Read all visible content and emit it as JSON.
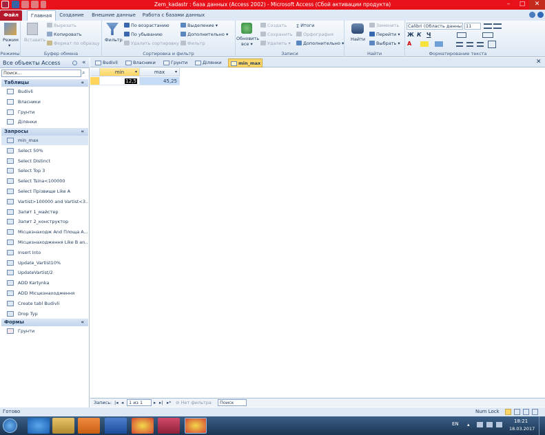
{
  "window": {
    "title": "Zem_kadastr : база данных (Access 2002) - Microsoft Access (Сбой активации продукта)"
  },
  "ribbon_tabs": [
    "Файл",
    "Главная",
    "Создание",
    "Внешние данные",
    "Работа с базами данных"
  ],
  "ribbon": {
    "views": {
      "label": "Режим",
      "group": "Режимы"
    },
    "clipboard": {
      "paste": "Вставить",
      "cut": "Вырезать",
      "copy": "Копировать",
      "format_painter": "Формат по образцу",
      "group": "Буфер обмена"
    },
    "sort_filter": {
      "filter": "Фильтр",
      "ascending": "По возрастанию",
      "descending": "По убыванию",
      "remove_sort": "Удалить сортировку",
      "selection": "Выделение",
      "advanced": "Дополнительно",
      "toggle_filter": "Фильтр",
      "group": "Сортировка и фильтр"
    },
    "records": {
      "refresh": "Обновить",
      "refresh_sub": "все",
      "new": "Создать",
      "save": "Сохранить",
      "delete": "Удалить",
      "totals": "Итоги",
      "spelling": "Орфография",
      "more": "Дополнительно",
      "group": "Записи"
    },
    "find": {
      "find": "Найти",
      "replace": "Заменить",
      "goto": "Перейти",
      "select": "Выбрать",
      "group": "Найти"
    },
    "text_format": {
      "font": "Calibri (Область данны",
      "size": "11",
      "group": "Форматирование текста"
    }
  },
  "nav": {
    "header": "Все объекты Access",
    "search_placeholder": "Поиск...",
    "categories": {
      "tables": {
        "label": "Таблицы",
        "items": [
          "Budivli",
          "Власники",
          "Грунти",
          "Ділянки"
        ]
      },
      "queries": {
        "label": "Запросы",
        "items": [
          "min_max",
          "Select 50%",
          "Select Distinct",
          "Select Top 3",
          "Select Tsina<100000",
          "Select Прізвище Like A",
          "Vartist>100000 and Vartist<3...",
          "Запит 1_майстер",
          "Запит 2_конструктор",
          "Місцезнаходж And Площа A...",
          "Місцезнаходження Like В an...",
          "Insert Into",
          "Update_Vartist10%",
          "UpdateVartist/2",
          "ADD Kartynka",
          "ADD Місцезнаходження",
          "Create tabl Budivli",
          "Drop Typ"
        ]
      },
      "forms": {
        "label": "Формы",
        "items": [
          "Грунти"
        ]
      }
    }
  },
  "doc_tabs": [
    "Budivli",
    "Власники",
    "Грунти",
    "Ділянки",
    "min_max"
  ],
  "grid": {
    "columns": [
      "min",
      "max"
    ],
    "rows": [
      [
        "12,5",
        "45,25"
      ]
    ]
  },
  "record_nav": {
    "label": "Запись:",
    "position": "1 из 1",
    "no_filter": "Нет фильтра",
    "search": "Поиск"
  },
  "status": {
    "left": "Готово",
    "numlock": "Num Lock"
  },
  "taskbar": {
    "lang": "EN",
    "time": "18:21",
    "date": "18.03.2017"
  }
}
